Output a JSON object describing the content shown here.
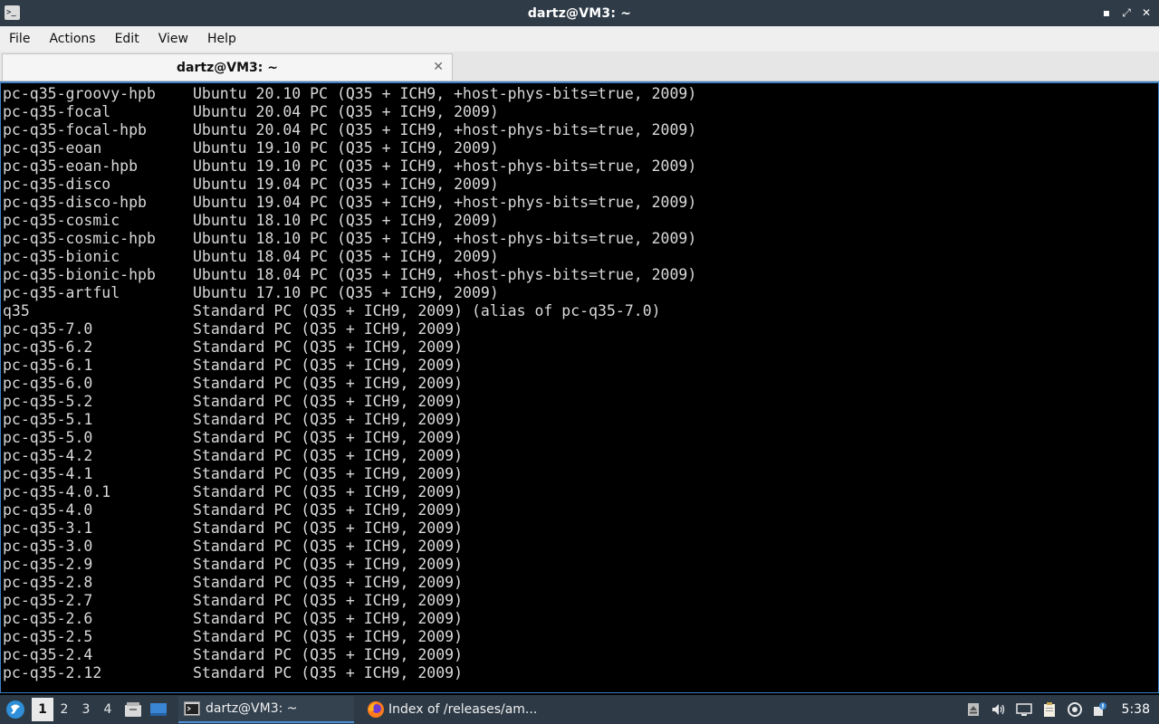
{
  "window": {
    "title": "dartz@VM3: ~",
    "app_icon_glyph": ">_",
    "controls": {
      "minimize": "▪",
      "maximize": "⤢",
      "close": "✕"
    }
  },
  "menu": [
    "File",
    "Actions",
    "Edit",
    "View",
    "Help"
  ],
  "tabs": [
    {
      "label": "dartz@VM3: ~",
      "close_glyph": "✕"
    }
  ],
  "terminal_lines": [
    {
      "name": "pc-q35-groovy-hpb",
      "desc": "Ubuntu 20.10 PC (Q35 + ICH9, +host-phys-bits=true, 2009)"
    },
    {
      "name": "pc-q35-focal",
      "desc": "Ubuntu 20.04 PC (Q35 + ICH9, 2009)"
    },
    {
      "name": "pc-q35-focal-hpb",
      "desc": "Ubuntu 20.04 PC (Q35 + ICH9, +host-phys-bits=true, 2009)"
    },
    {
      "name": "pc-q35-eoan",
      "desc": "Ubuntu 19.10 PC (Q35 + ICH9, 2009)"
    },
    {
      "name": "pc-q35-eoan-hpb",
      "desc": "Ubuntu 19.10 PC (Q35 + ICH9, +host-phys-bits=true, 2009)"
    },
    {
      "name": "pc-q35-disco",
      "desc": "Ubuntu 19.04 PC (Q35 + ICH9, 2009)"
    },
    {
      "name": "pc-q35-disco-hpb",
      "desc": "Ubuntu 19.04 PC (Q35 + ICH9, +host-phys-bits=true, 2009)"
    },
    {
      "name": "pc-q35-cosmic",
      "desc": "Ubuntu 18.10 PC (Q35 + ICH9, 2009)"
    },
    {
      "name": "pc-q35-cosmic-hpb",
      "desc": "Ubuntu 18.10 PC (Q35 + ICH9, +host-phys-bits=true, 2009)"
    },
    {
      "name": "pc-q35-bionic",
      "desc": "Ubuntu 18.04 PC (Q35 + ICH9, 2009)"
    },
    {
      "name": "pc-q35-bionic-hpb",
      "desc": "Ubuntu 18.04 PC (Q35 + ICH9, +host-phys-bits=true, 2009)"
    },
    {
      "name": "pc-q35-artful",
      "desc": "Ubuntu 17.10 PC (Q35 + ICH9, 2009)"
    },
    {
      "name": "q35",
      "desc": "Standard PC (Q35 + ICH9, 2009) (alias of pc-q35-7.0)"
    },
    {
      "name": "pc-q35-7.0",
      "desc": "Standard PC (Q35 + ICH9, 2009)"
    },
    {
      "name": "pc-q35-6.2",
      "desc": "Standard PC (Q35 + ICH9, 2009)"
    },
    {
      "name": "pc-q35-6.1",
      "desc": "Standard PC (Q35 + ICH9, 2009)"
    },
    {
      "name": "pc-q35-6.0",
      "desc": "Standard PC (Q35 + ICH9, 2009)"
    },
    {
      "name": "pc-q35-5.2",
      "desc": "Standard PC (Q35 + ICH9, 2009)"
    },
    {
      "name": "pc-q35-5.1",
      "desc": "Standard PC (Q35 + ICH9, 2009)"
    },
    {
      "name": "pc-q35-5.0",
      "desc": "Standard PC (Q35 + ICH9, 2009)"
    },
    {
      "name": "pc-q35-4.2",
      "desc": "Standard PC (Q35 + ICH9, 2009)"
    },
    {
      "name": "pc-q35-4.1",
      "desc": "Standard PC (Q35 + ICH9, 2009)"
    },
    {
      "name": "pc-q35-4.0.1",
      "desc": "Standard PC (Q35 + ICH9, 2009)"
    },
    {
      "name": "pc-q35-4.0",
      "desc": "Standard PC (Q35 + ICH9, 2009)"
    },
    {
      "name": "pc-q35-3.1",
      "desc": "Standard PC (Q35 + ICH9, 2009)"
    },
    {
      "name": "pc-q35-3.0",
      "desc": "Standard PC (Q35 + ICH9, 2009)"
    },
    {
      "name": "pc-q35-2.9",
      "desc": "Standard PC (Q35 + ICH9, 2009)"
    },
    {
      "name": "pc-q35-2.8",
      "desc": "Standard PC (Q35 + ICH9, 2009)"
    },
    {
      "name": "pc-q35-2.7",
      "desc": "Standard PC (Q35 + ICH9, 2009)"
    },
    {
      "name": "pc-q35-2.6",
      "desc": "Standard PC (Q35 + ICH9, 2009)"
    },
    {
      "name": "pc-q35-2.5",
      "desc": "Standard PC (Q35 + ICH9, 2009)"
    },
    {
      "name": "pc-q35-2.4",
      "desc": "Standard PC (Q35 + ICH9, 2009)"
    },
    {
      "name": "pc-q35-2.12",
      "desc": "Standard PC (Q35 + ICH9, 2009)"
    }
  ],
  "taskbar": {
    "desktops": [
      "1",
      "2",
      "3",
      "4"
    ],
    "active_desktop": "1",
    "tasks": [
      {
        "label": "dartz@VM3: ~",
        "icon": "terminal-icon"
      },
      {
        "label": "Index of /releases/am...",
        "icon": "firefox-icon"
      }
    ],
    "clock": "5:38",
    "tray_icons": [
      "eject-icon",
      "volume-icon",
      "monitor-icon",
      "clipboard-icon",
      "update-icon",
      "network-icon"
    ]
  },
  "colors": {
    "titlebar_bg": "#2f3b47",
    "terminal_bg": "#000000",
    "terminal_fg": "#d9d9d9",
    "terminal_border": "#3d7fc4",
    "taskbar_bg": "#2d3a46"
  }
}
